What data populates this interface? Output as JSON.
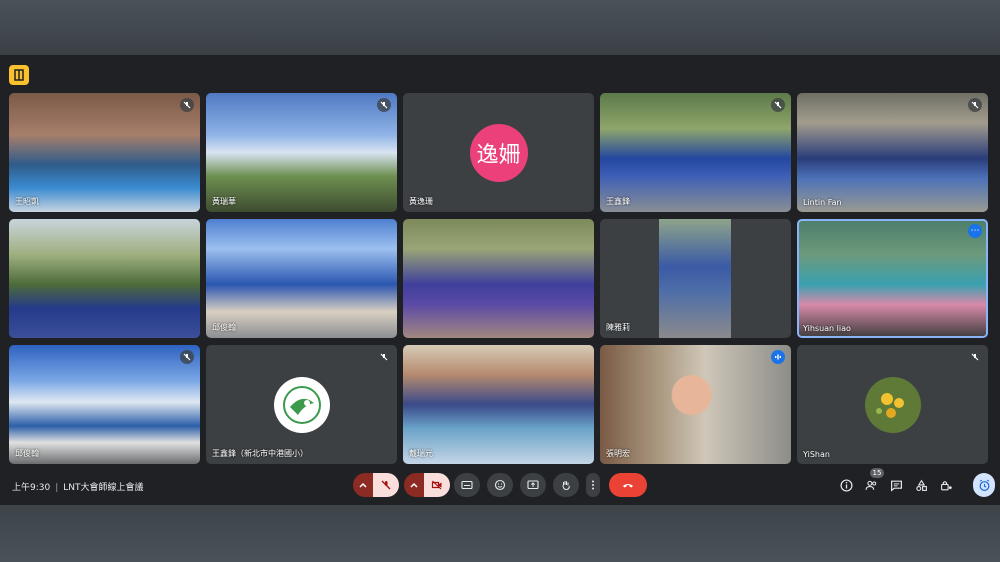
{
  "meeting": {
    "time": "上午9:30",
    "separator": "|",
    "title": "LNT大會師線上會議",
    "participant_count": "15"
  },
  "avatar_initials": "逸姍",
  "colors": {
    "background": "#202124",
    "tile": "#3c4043",
    "hangup": "#ea4335",
    "highlight": "#8ab4f8",
    "avatar": "#ec407a"
  },
  "tiles": [
    {
      "name": "王昭凱",
      "kind": "photo",
      "muted": true
    },
    {
      "name": "黃瑞華",
      "kind": "photo",
      "muted": true
    },
    {
      "name": "黃逸珊",
      "kind": "avatar",
      "muted": false
    },
    {
      "name": "王鑫鋒",
      "kind": "photo",
      "muted": true
    },
    {
      "name": "Lintin Fan",
      "kind": "photo",
      "muted": true
    },
    {
      "name": "",
      "kind": "photo",
      "muted": false
    },
    {
      "name": "邱俊翰",
      "kind": "photo",
      "muted": false
    },
    {
      "name": "",
      "kind": "photo",
      "muted": false
    },
    {
      "name": "陳雅莉",
      "kind": "photo",
      "muted": false
    },
    {
      "name": "Yihsuan liao",
      "kind": "photo",
      "muted": false,
      "highlighted": true
    },
    {
      "name": "邱俊翰",
      "kind": "photo",
      "muted": true
    },
    {
      "name": "王鑫鋒（新北市中港國小）",
      "kind": "logo",
      "muted": true
    },
    {
      "name": "戴瑞元",
      "kind": "photo",
      "muted": false
    },
    {
      "name": "張明宏",
      "kind": "photo",
      "muted": false,
      "speaking": true
    },
    {
      "name": "YiShan",
      "kind": "flower",
      "muted": true
    }
  ],
  "controls": [
    "mic-toggle",
    "camera-toggle",
    "captions",
    "emoji",
    "present",
    "raise-hand",
    "more-options",
    "leave-call"
  ],
  "right_controls": [
    "info",
    "people",
    "chat",
    "activities",
    "host-controls",
    "activity-panel"
  ]
}
